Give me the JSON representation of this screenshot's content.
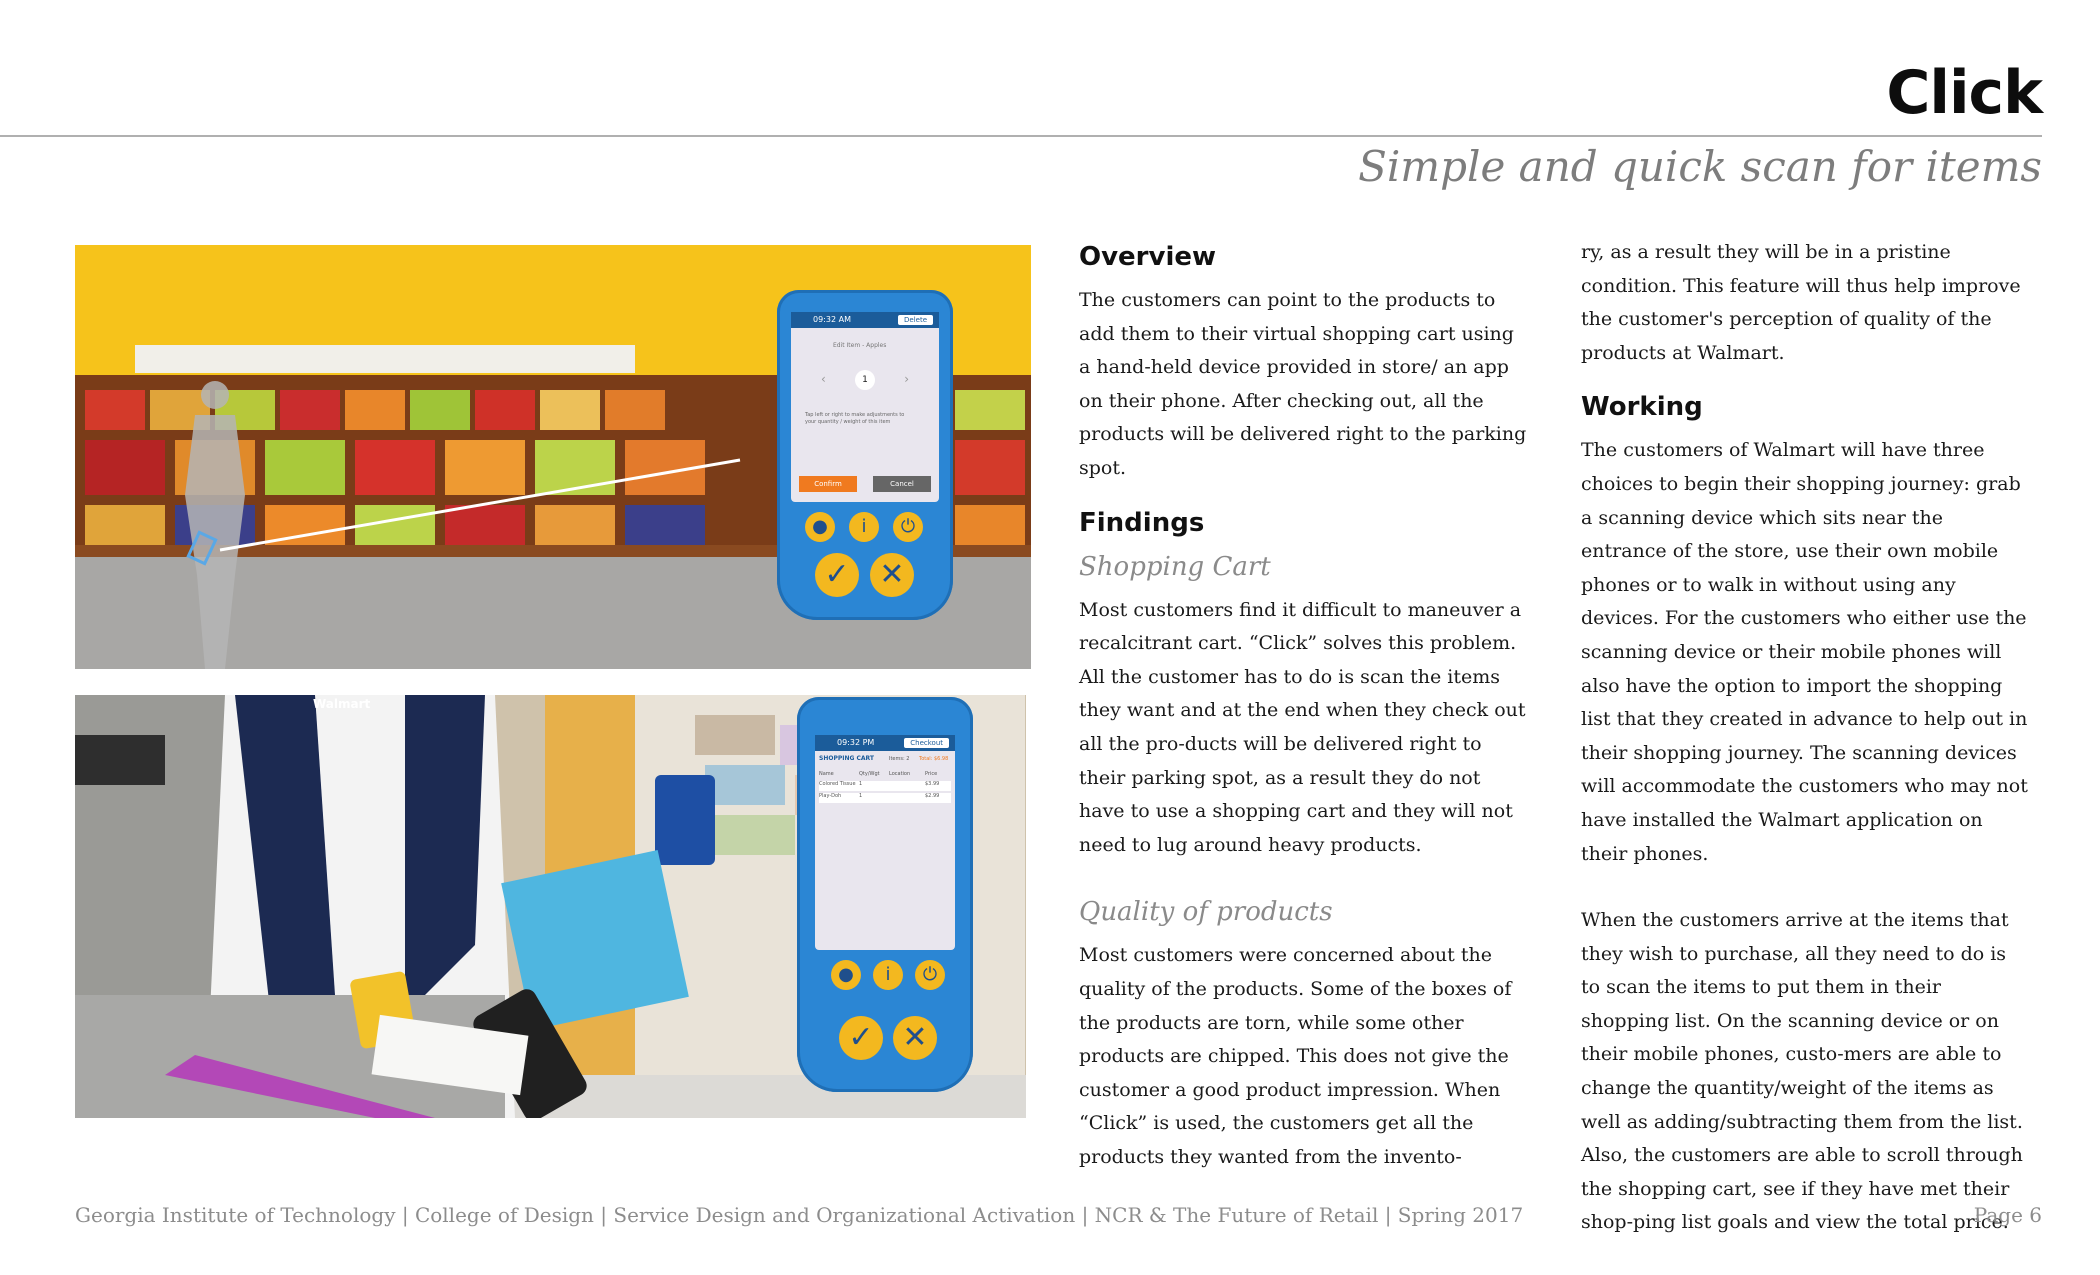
{
  "header": {
    "title": "Click",
    "subtitle": "Simple and quick scan for items"
  },
  "images": {
    "top": {
      "screen_time": "09:32 AM",
      "screen_button": "Delete",
      "edit_item": "Edit Item - Apples",
      "quantity": "1",
      "hint": "Tap left or right to make adjustments to your quantity / weight of this item",
      "confirm": "Confirm",
      "cancel": "Cancel"
    },
    "bottom": {
      "screen_time": "09:32 PM",
      "screen_button": "Checkout",
      "cart_title": "SHOPPING CART",
      "cart_items": "Items: 2",
      "cart_total": "Total: $6.98",
      "columns": [
        "Name",
        "Qty/Wgt",
        "Location",
        "Price"
      ],
      "rows": [
        [
          "Colored Tissue",
          "1",
          "",
          "$3.99"
        ],
        [
          "Play-Doh",
          "1",
          "",
          "$2.99"
        ]
      ],
      "vest_text": "Walmart"
    }
  },
  "col1": {
    "overview_heading": "Overview",
    "overview_text": "The customers can point to the products to add them to their virtual shopping cart using a hand-held device provided in store/ an app on their phone. After checking out, all the products will be delivered right to the parking spot.",
    "findings_heading": "Findings",
    "cart_subheading": "Shopping Cart",
    "cart_text": "Most customers find it difficult to maneuver a recalcitrant cart. “Click” solves this problem. All the customer has to do is scan the items they want and at the end when they check out all the pro-ducts will be delivered right to their parking spot, as a result they do not have to use a shopping cart and they will not need to lug around heavy products.",
    "quality_subheading": "Quality of products",
    "quality_text": "Most customers were concerned about the quality of the products. Some of the boxes of the products are torn, while some other products are chipped. This does not give the customer a good product impression. When “Click” is used, the customers get all the products they wanted from the invento-"
  },
  "col2": {
    "continued_text": "ry, as a result they will be in a pristine condition. This feature  will thus help improve the customer's perception of quality of the products at Walmart.",
    "working_heading": "Working",
    "working_text_1": "The customers of Walmart will have three choices to begin their shopping journey: grab a scanning device which sits near the entrance of the store, use their own mobile phones or to walk in without using any devices. For the customers who either use the scanning device or their mobile phones will also have the option to import the shopping list that they created in advance to help out in their shopping journey. The scanning devices will accommodate the customers who may not have installed the Walmart application on their phones.",
    "working_text_2": "When the customers arrive at the items that they wish to purchase, all they need to do is to scan the items to put them in their shopping list. On the scanning device or on their mobile phones, custo-mers are able to change the quantity/weight of the items as well as adding/subtracting them from the list. Also, the customers are able to scroll through the shopping cart, see if they have met their shop-ping list goals and view the total price."
  },
  "footer": {
    "left": "Georgia Institute of Technology | College of Design | Service Design and Organizational Activation | NCR & The Future of Retail | Spring 2017",
    "right": "Page 6"
  },
  "icons": {
    "user": "user-icon",
    "info": "info-icon",
    "power": "power-icon",
    "check": "check-icon",
    "close": "close-icon"
  },
  "colors": {
    "device_blue": "#2b86d4",
    "button_yellow": "#f3b81f",
    "confirm_orange": "#f07a1f",
    "background_yellow": "#f7c51a"
  }
}
